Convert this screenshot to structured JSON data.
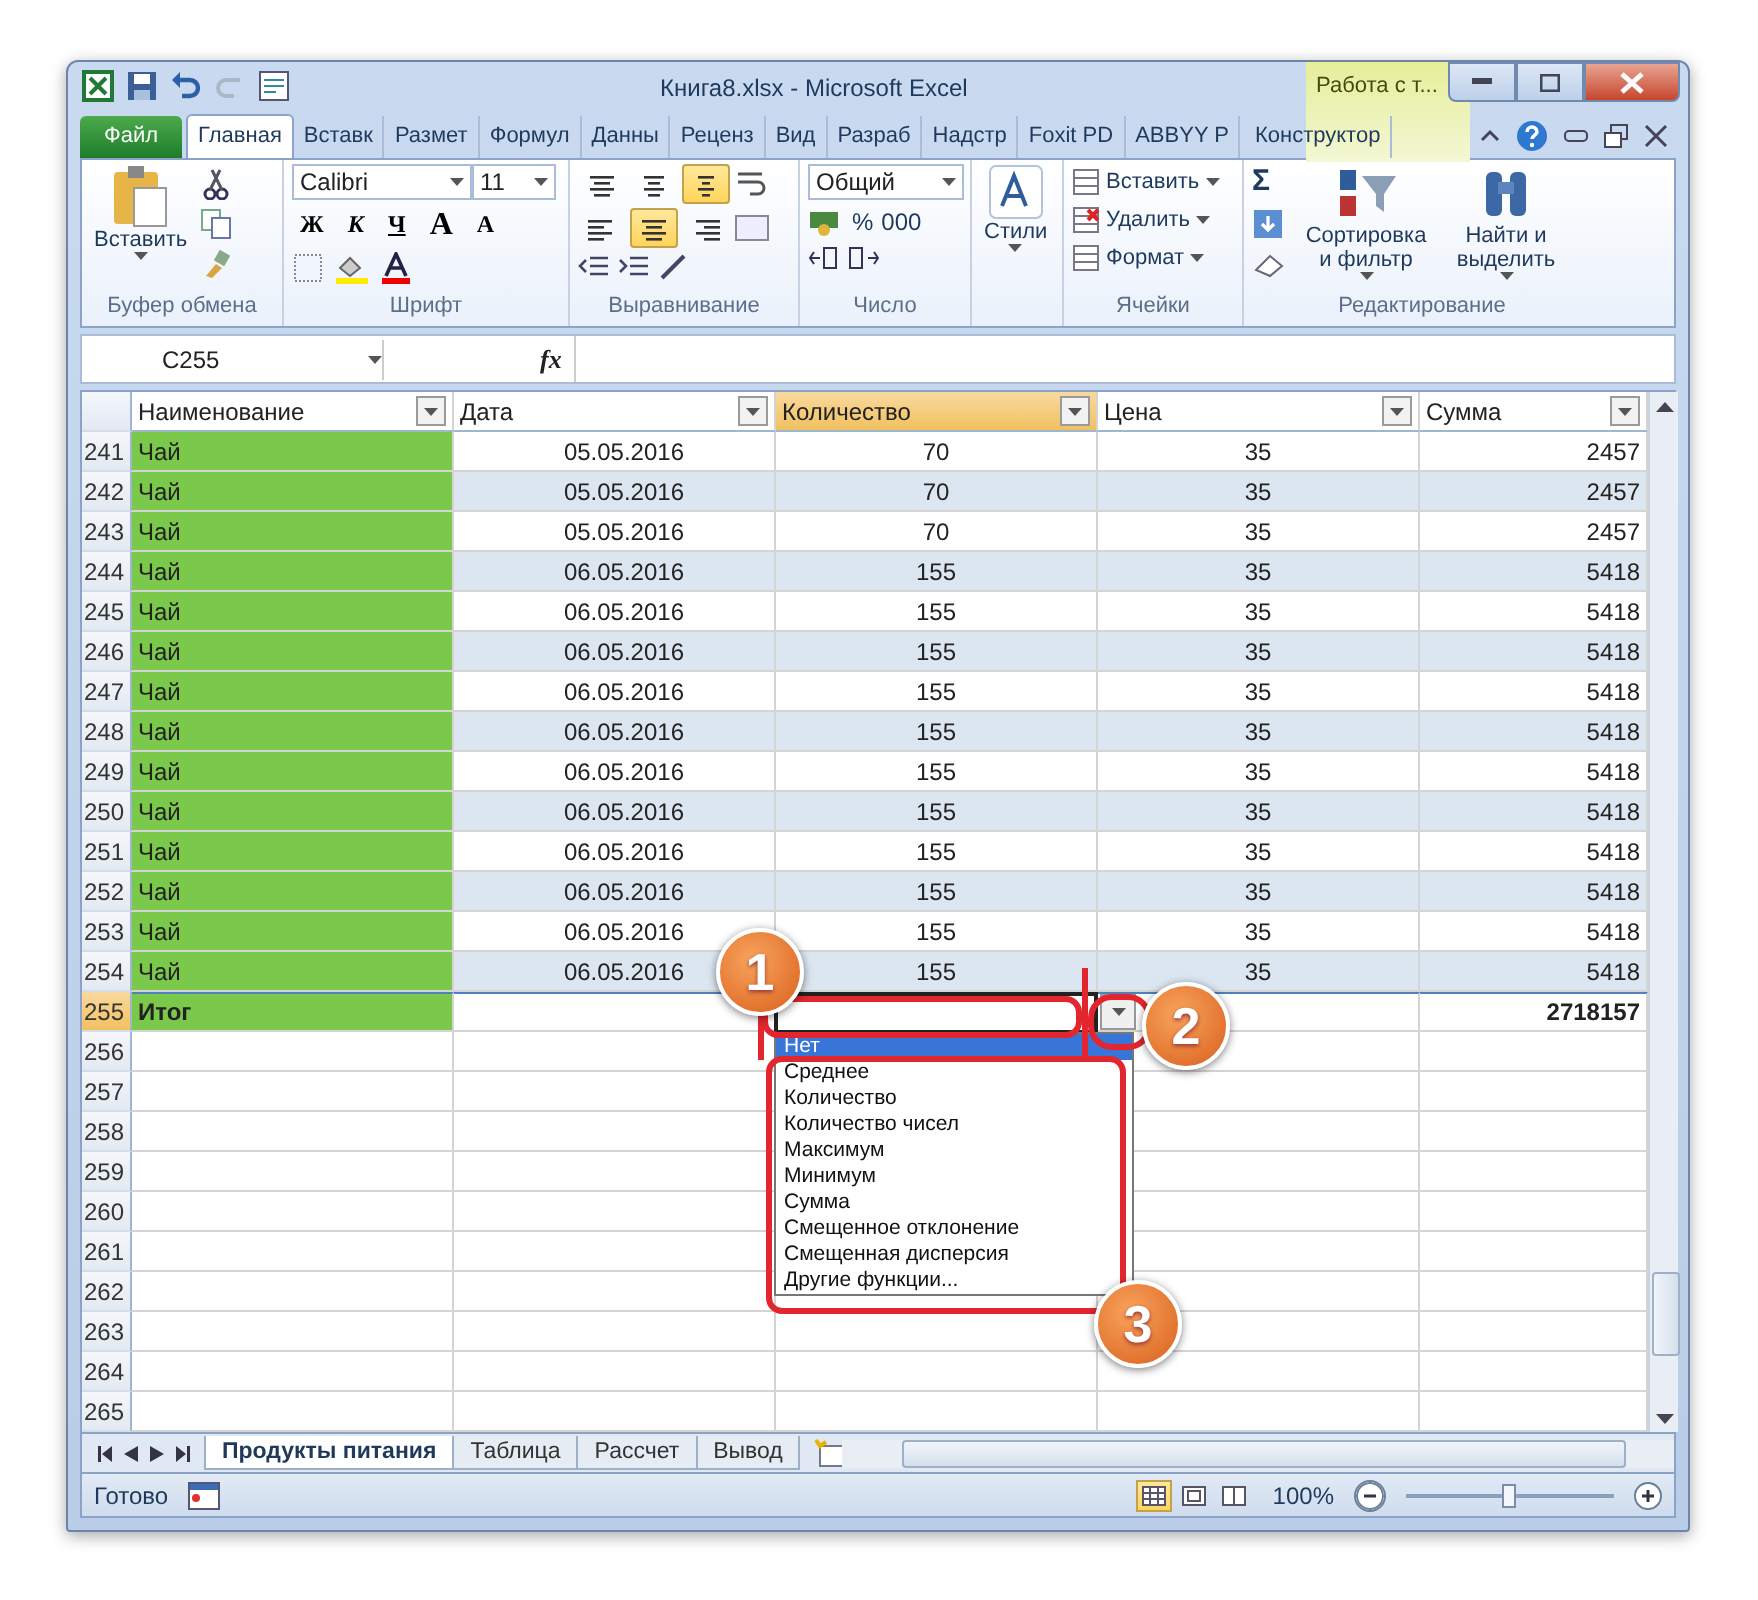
{
  "window": {
    "title": "Книга8.xlsx - Microsoft Excel",
    "context_tab": "Работа с т..."
  },
  "ribbon_tabs": [
    {
      "label": "Файл",
      "kind": "file",
      "selected": false
    },
    {
      "label": "Главная",
      "kind": "tab",
      "selected": true
    },
    {
      "label": "Вставк",
      "kind": "tab",
      "selected": false
    },
    {
      "label": "Размет",
      "kind": "tab",
      "selected": false
    },
    {
      "label": "Формул",
      "kind": "tab",
      "selected": false
    },
    {
      "label": "Данны",
      "kind": "tab",
      "selected": false
    },
    {
      "label": "Реценз",
      "kind": "tab",
      "selected": false
    },
    {
      "label": "Вид",
      "kind": "tab",
      "selected": false
    },
    {
      "label": "Разраб",
      "kind": "tab",
      "selected": false
    },
    {
      "label": "Надстр",
      "kind": "tab",
      "selected": false
    },
    {
      "label": "Foxit PD",
      "kind": "tab",
      "selected": false
    },
    {
      "label": "ABBYY P",
      "kind": "tab",
      "selected": false
    },
    {
      "label": "Конструктор",
      "kind": "context",
      "selected": false
    }
  ],
  "ribbon": {
    "clipboard": {
      "paste": "Вставить",
      "label": "Буфер обмена"
    },
    "font": {
      "name": "Calibri",
      "size": "11",
      "styles": [
        "Ж",
        "К",
        "Ч"
      ],
      "grow": "A",
      "shrink": "A",
      "label": "Шрифт"
    },
    "alignment": {
      "vertical": [
        {
          "selected": false
        },
        {
          "selected": false
        },
        {
          "selected": true
        }
      ],
      "horizontal": [
        {
          "selected": false
        },
        {
          "selected": true
        },
        {
          "selected": false
        }
      ],
      "label": "Выравнивание"
    },
    "number": {
      "format": "Общий",
      "percent": "%",
      "thousands": "000",
      "label": "Число"
    },
    "styles": {
      "button": "Стили"
    },
    "cells": {
      "buttons": [
        "Вставить",
        "Удалить",
        "Формат"
      ],
      "label": "Ячейки"
    },
    "editing": {
      "sum": "Σ",
      "sort": "Сортировка и фильтр",
      "find": "Найти и выделить",
      "label": "Редактирование"
    }
  },
  "formula_bar": {
    "name_box": "C255",
    "fx": "fx"
  },
  "sheet": {
    "columns": [
      {
        "label": "Наименование",
        "selected": false
      },
      {
        "label": "Дата",
        "selected": false
      },
      {
        "label": "Количество",
        "selected": true
      },
      {
        "label": "Цена",
        "selected": false
      },
      {
        "label": "Сумма",
        "selected": false
      }
    ],
    "rows": [
      {
        "n": "241",
        "kind": "data",
        "selected": false,
        "cells": [
          "Чай",
          "05.05.2016",
          "70",
          "35",
          "2457"
        ]
      },
      {
        "n": "242",
        "kind": "data",
        "selected": false,
        "cells": [
          "Чай",
          "05.05.2016",
          "70",
          "35",
          "2457"
        ]
      },
      {
        "n": "243",
        "kind": "data",
        "selected": false,
        "cells": [
          "Чай",
          "05.05.2016",
          "70",
          "35",
          "2457"
        ]
      },
      {
        "n": "244",
        "kind": "data",
        "selected": false,
        "cells": [
          "Чай",
          "06.05.2016",
          "155",
          "35",
          "5418"
        ]
      },
      {
        "n": "245",
        "kind": "data",
        "selected": false,
        "cells": [
          "Чай",
          "06.05.2016",
          "155",
          "35",
          "5418"
        ]
      },
      {
        "n": "246",
        "kind": "data",
        "selected": false,
        "cells": [
          "Чай",
          "06.05.2016",
          "155",
          "35",
          "5418"
        ]
      },
      {
        "n": "247",
        "kind": "data",
        "selected": false,
        "cells": [
          "Чай",
          "06.05.2016",
          "155",
          "35",
          "5418"
        ]
      },
      {
        "n": "248",
        "kind": "data",
        "selected": false,
        "cells": [
          "Чай",
          "06.05.2016",
          "155",
          "35",
          "5418"
        ]
      },
      {
        "n": "249",
        "kind": "data",
        "selected": false,
        "cells": [
          "Чай",
          "06.05.2016",
          "155",
          "35",
          "5418"
        ]
      },
      {
        "n": "250",
        "kind": "data",
        "selected": false,
        "cells": [
          "Чай",
          "06.05.2016",
          "155",
          "35",
          "5418"
        ]
      },
      {
        "n": "251",
        "kind": "data",
        "selected": false,
        "cells": [
          "Чай",
          "06.05.2016",
          "155",
          "35",
          "5418"
        ]
      },
      {
        "n": "252",
        "kind": "data",
        "selected": false,
        "cells": [
          "Чай",
          "06.05.2016",
          "155",
          "35",
          "5418"
        ]
      },
      {
        "n": "253",
        "kind": "data",
        "selected": false,
        "cells": [
          "Чай",
          "06.05.2016",
          "155",
          "35",
          "5418"
        ]
      },
      {
        "n": "254",
        "kind": "data",
        "selected": false,
        "cells": [
          "Чай",
          "06.05.2016",
          "155",
          "35",
          "5418"
        ]
      },
      {
        "n": "255",
        "kind": "total",
        "selected": true,
        "label": "Итог",
        "sum": "2718157"
      },
      {
        "n": "256",
        "kind": "empty",
        "selected": false
      },
      {
        "n": "257",
        "kind": "empty",
        "selected": false
      },
      {
        "n": "258",
        "kind": "empty",
        "selected": false
      },
      {
        "n": "259",
        "kind": "empty",
        "selected": false
      },
      {
        "n": "260",
        "kind": "empty",
        "selected": false
      },
      {
        "n": "261",
        "kind": "empty",
        "selected": false
      },
      {
        "n": "262",
        "kind": "empty",
        "selected": false
      },
      {
        "n": "263",
        "kind": "empty",
        "selected": false
      },
      {
        "n": "264",
        "kind": "empty",
        "selected": false
      },
      {
        "n": "265",
        "kind": "empty",
        "selected": false
      }
    ]
  },
  "dropdown": {
    "items": [
      {
        "label": "Нет",
        "selected": true
      },
      {
        "label": "Среднее",
        "selected": false
      },
      {
        "label": "Количество",
        "selected": false
      },
      {
        "label": "Количество чисел",
        "selected": false
      },
      {
        "label": "Максимум",
        "selected": false
      },
      {
        "label": "Минимум",
        "selected": false
      },
      {
        "label": "Сумма",
        "selected": false
      },
      {
        "label": "Смещенное отклонение",
        "selected": false
      },
      {
        "label": "Смещенная дисперсия",
        "selected": false
      },
      {
        "label": "Другие функции...",
        "selected": false
      }
    ]
  },
  "callouts": [
    {
      "label": "1"
    },
    {
      "label": "2"
    },
    {
      "label": "3"
    }
  ],
  "sheet_tabs": [
    {
      "label": "Продукты питания",
      "selected": true
    },
    {
      "label": "Таблица",
      "selected": false
    },
    {
      "label": "Рассчет",
      "selected": false
    },
    {
      "label": "Вывод",
      "selected": false
    }
  ],
  "status_bar": {
    "status": "Готово",
    "views": [
      {
        "selected": true
      },
      {
        "selected": false
      },
      {
        "selected": false
      }
    ],
    "zoom": "100%",
    "zoom_slider": {
      "level": 0.5
    }
  }
}
